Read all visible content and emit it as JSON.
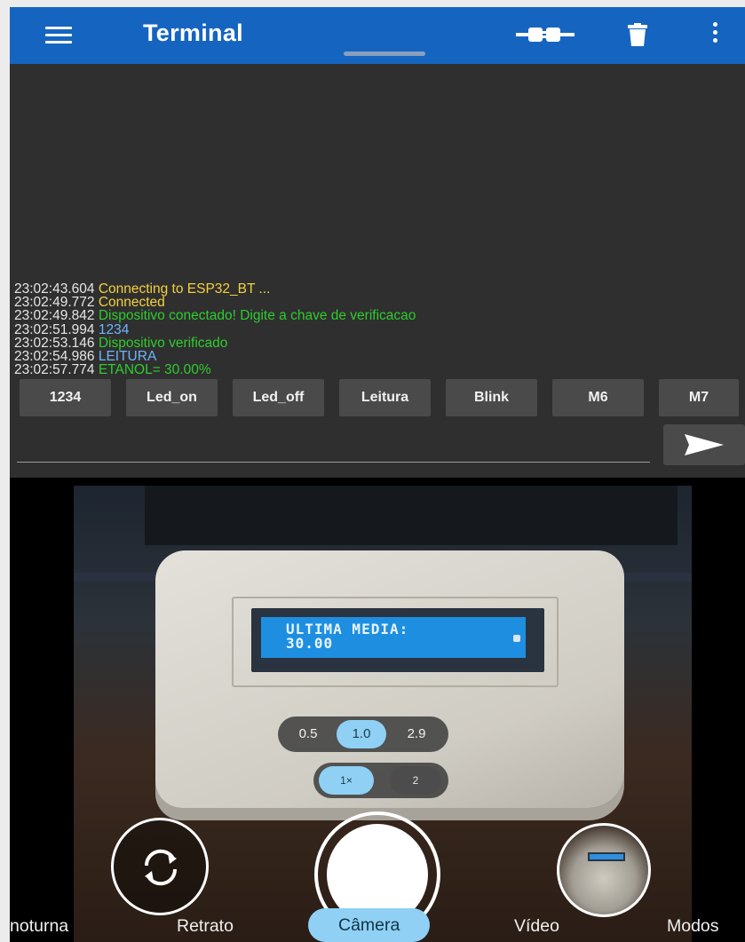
{
  "topbar": {
    "title": "Terminal",
    "icons": {
      "menu": "hamburger-menu-icon",
      "connect": "plug-connection-icon",
      "clear": "trash-icon",
      "more": "more-vertical-icon"
    },
    "color": "#1565c0"
  },
  "terminal": {
    "log": [
      {
        "time": "23:02:43.604",
        "message": "Connecting to ESP32_BT ...",
        "kind": "status",
        "color": "#f4d03f"
      },
      {
        "time": "23:02:49.772",
        "message": "Connected",
        "kind": "status",
        "color": "#f4d03f"
      },
      {
        "time": "23:02:49.842",
        "message": "Dispositivo conectado! Digite a chave de verificacao",
        "kind": "received",
        "color": "#2ecc2e"
      },
      {
        "time": "23:02:51.994",
        "message": "1234",
        "kind": "sent",
        "color": "#6fb4ff"
      },
      {
        "time": "23:02:53.146",
        "message": "Dispositivo verificado",
        "kind": "received",
        "color": "#2ecc2e"
      },
      {
        "time": "23:02:54.986",
        "message": "LEITURA",
        "kind": "sent",
        "color": "#6fb4ff"
      },
      {
        "time": "23:02:57.774",
        "message": "ETANOL= 30.00%",
        "kind": "received",
        "color": "#2ecc2e"
      }
    ],
    "macros": [
      "1234",
      "Led_on",
      "Led_off",
      "Leitura",
      "Blink",
      "M6",
      "M7"
    ],
    "input": {
      "value": "",
      "placeholder": ""
    },
    "send_icon": "send-arrow-icon"
  },
  "camera": {
    "lcd_line1": "ULTIMA MEDIA:",
    "lcd_line2": "30.00",
    "zoom_options": [
      "0.5",
      "1.0",
      "2.9"
    ],
    "zoom_selected": "1.0",
    "lens_options": [
      "1×",
      "2"
    ],
    "lens_selected": "1×",
    "modes": [
      "noturna",
      "Retrato",
      "Câmera",
      "Vídeo",
      "Modos"
    ],
    "mode_selected": "Câmera",
    "accent": "#8fd0f4",
    "icons": {
      "flip": "switch-camera-icon",
      "shutter": "shutter-button",
      "gallery": "gallery-thumbnail"
    }
  }
}
